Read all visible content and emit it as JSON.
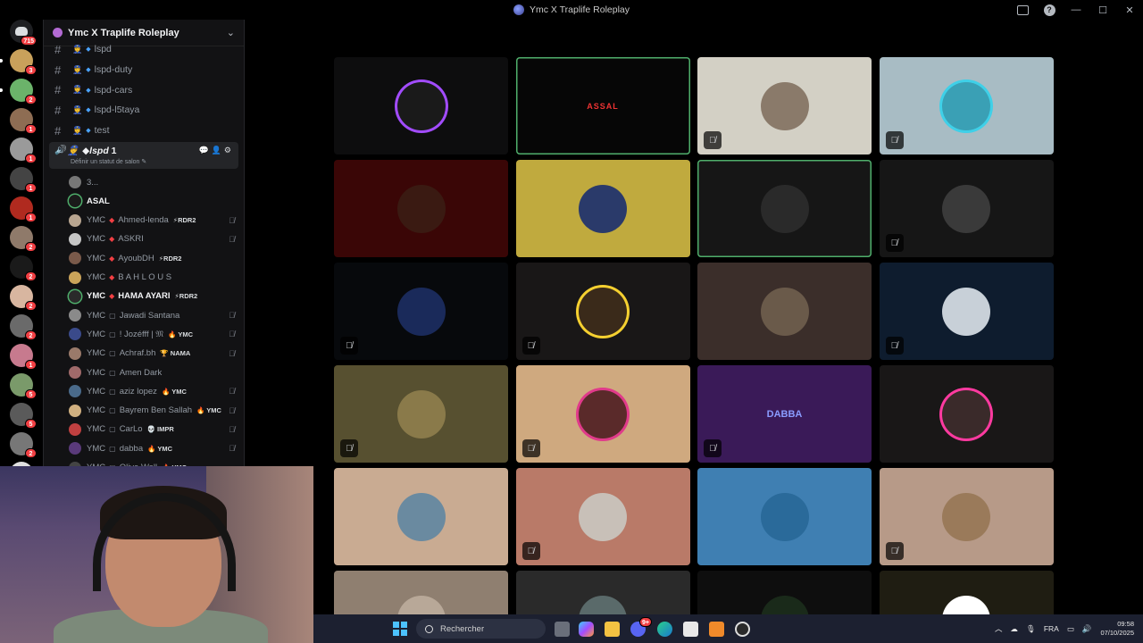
{
  "window": {
    "title": "Ymc X Traplife Roleplay"
  },
  "rail": {
    "home_badge": "715",
    "servers": [
      {
        "color": "#c9a15b",
        "badge": "3"
      },
      {
        "color": "#6bb36a",
        "badge": "2"
      },
      {
        "color": "#8e6d53",
        "badge": "1"
      },
      {
        "color": "#9a9a9a",
        "badge": "1"
      },
      {
        "color": "#444444",
        "badge": "1"
      },
      {
        "color": "#b02a1f",
        "badge": "1"
      },
      {
        "color": "#8f7a6a",
        "badge": "2"
      },
      {
        "color": "#1a1a1a",
        "badge": "2"
      },
      {
        "color": "#d8b6a0",
        "badge": "2"
      },
      {
        "color": "#6a6a6a",
        "badge": "2"
      },
      {
        "color": "#c77a8e",
        "badge": "1"
      },
      {
        "color": "#7a9a6a",
        "badge": "5"
      },
      {
        "color": "#5a5a5a",
        "badge": "5"
      },
      {
        "color": "#777777",
        "badge": "2"
      },
      {
        "color": "#e0e0e0",
        "badge": ""
      }
    ]
  },
  "guild": {
    "name": "Ymc X Traplife Roleplay"
  },
  "channels": [
    "lspd",
    "lspd-duty",
    "lspd-cars",
    "lspd-l5taya",
    "test"
  ],
  "voice": {
    "name": "lspd",
    "count": "1",
    "status_placeholder": "Définir un statut de salon ✎"
  },
  "members": [
    {
      "prefix": "",
      "name": "3...",
      "tag": "",
      "color": "#777777",
      "mark": "",
      "muted": false,
      "bright": false
    },
    {
      "prefix": "",
      "name": "ASAL",
      "tag": "",
      "color": "#1a1a1a",
      "mark": "",
      "muted": false,
      "bright": true
    },
    {
      "prefix": "YMC",
      "name": "Ahmed-lenda",
      "tag": "⚡RDR2",
      "color": "#b8a590",
      "mark": "◆",
      "muted": true,
      "bright": false
    },
    {
      "prefix": "YMC",
      "name": "ASKRI",
      "tag": "",
      "color": "#c5c5c5",
      "mark": "◆",
      "muted": true,
      "bright": false
    },
    {
      "prefix": "YMC",
      "name": "AyoubDH",
      "tag": "⚡RDR2",
      "color": "#7a5a4a",
      "mark": "◆",
      "muted": false,
      "bright": false
    },
    {
      "prefix": "YMC",
      "name": "B A H L O U S",
      "tag": "",
      "color": "#caa45a",
      "mark": "◆",
      "muted": false,
      "bright": false
    },
    {
      "prefix": "YMC",
      "name": "HAMA AYARI",
      "tag": "⚡RDR2",
      "color": "#2a2a2a",
      "mark": "◆",
      "muted": false,
      "bright": true
    },
    {
      "prefix": "YMC",
      "name": "Jawadi Santana",
      "tag": "",
      "color": "#8a8a8a",
      "mark": "▢",
      "muted": true,
      "bright": false
    },
    {
      "prefix": "YMC",
      "name": "! Jozéfff | 𝔐",
      "tag": "🔥 YMC",
      "color": "#3a4a8a",
      "mark": "▢",
      "muted": true,
      "bright": false
    },
    {
      "prefix": "YMC",
      "name": "Achraf.bh",
      "tag": "🏆 NAMA",
      "color": "#9a7a6a",
      "mark": "▢",
      "muted": true,
      "bright": false
    },
    {
      "prefix": "YMC",
      "name": "Amen Dark",
      "tag": "",
      "color": "#a06a6a",
      "mark": "▢",
      "muted": false,
      "bright": false
    },
    {
      "prefix": "YMC",
      "name": "aziz lopez",
      "tag": "🔥 YMC",
      "color": "#4a6a8a",
      "mark": "▢",
      "muted": true,
      "bright": false
    },
    {
      "prefix": "YMC",
      "name": "Bayrem Ben Sallah",
      "tag": "🔥 YMC",
      "color": "#d0b080",
      "mark": "▢",
      "muted": true,
      "bright": false
    },
    {
      "prefix": "YMC",
      "name": "CarLo",
      "tag": "💀 IMPR",
      "color": "#c04040",
      "mark": "▢",
      "muted": true,
      "bright": false
    },
    {
      "prefix": "YMC",
      "name": "dabba",
      "tag": "🔥 YMC",
      "color": "#5a3a7a",
      "mark": "▢",
      "muted": true,
      "bright": false
    },
    {
      "prefix": "YMC",
      "name": "Olive Wall",
      "tag": "🔥 YMC",
      "color": "#444444",
      "mark": "▢",
      "muted": false,
      "bright": false
    }
  ],
  "tiles": [
    {
      "bg": "#0d0d0e",
      "av": "#1a1a1a",
      "ring": "#a24cff",
      "speaking": false,
      "muted": false,
      "text": ""
    },
    {
      "bg": "#060606",
      "av": "",
      "ring": "",
      "speaking": true,
      "muted": false,
      "text": "ASSAL"
    },
    {
      "bg": "#d3d0c5",
      "av": "#8a7a6a",
      "ring": "",
      "speaking": false,
      "muted": true,
      "text": ""
    },
    {
      "bg": "#a8bcc4",
      "av": "#3aa0b5",
      "ring": "#3fd0e8",
      "speaking": false,
      "muted": true,
      "text": ""
    },
    {
      "bg": "#3a0606",
      "av": "#3a1a12",
      "ring": "",
      "speaking": false,
      "muted": false,
      "text": ""
    },
    {
      "bg": "#c0aa3e",
      "av": "#2a3a6a",
      "ring": "",
      "speaking": false,
      "muted": false,
      "text": ""
    },
    {
      "bg": "#161616",
      "av": "#2a2a2a",
      "ring": "",
      "speaking": true,
      "muted": false,
      "text": ""
    },
    {
      "bg": "#161616",
      "av": "#3a3a3a",
      "ring": "",
      "speaking": false,
      "muted": true,
      "text": ""
    },
    {
      "bg": "#07090c",
      "av": "#1a2a5a",
      "ring": "",
      "speaking": false,
      "muted": true,
      "text": ""
    },
    {
      "bg": "#191717",
      "av": "#3a2a1a",
      "ring": "#f5d030",
      "speaking": false,
      "muted": true,
      "text": ""
    },
    {
      "bg": "#3b2e2a",
      "av": "#6a5a4a",
      "ring": "",
      "speaking": false,
      "muted": false,
      "text": ""
    },
    {
      "bg": "#0e1c2e",
      "av": "#c8d0d8",
      "ring": "",
      "speaking": false,
      "muted": true,
      "text": ""
    },
    {
      "bg": "#575030",
      "av": "#8a7a4a",
      "ring": "",
      "speaking": false,
      "muted": true,
      "text": ""
    },
    {
      "bg": "#cfa97f",
      "av": "#5a2a2a",
      "ring": "#e03a8a",
      "speaking": false,
      "muted": true,
      "text": ""
    },
    {
      "bg": "#3a1a58",
      "av": "",
      "ring": "",
      "speaking": false,
      "muted": true,
      "text": "DABBA"
    },
    {
      "bg": "#191717",
      "av": "#3a2a2a",
      "ring": "#ff3aa0",
      "speaking": false,
      "muted": false,
      "text": ""
    },
    {
      "bg": "#c9ab92",
      "av": "#6a8aa0",
      "ring": "",
      "speaking": false,
      "muted": false,
      "text": ""
    },
    {
      "bg": "#b97a68",
      "av": "#c8c0b8",
      "ring": "",
      "speaking": false,
      "muted": true,
      "text": ""
    },
    {
      "bg": "#3f7fb2",
      "av": "#2a6a9a",
      "ring": "",
      "speaking": false,
      "muted": false,
      "text": ""
    },
    {
      "bg": "#b79a88",
      "av": "#9a7a5a",
      "ring": "",
      "speaking": false,
      "muted": true,
      "text": ""
    },
    {
      "bg": "#8f7f70",
      "av": "#b8a898",
      "ring": "",
      "speaking": false,
      "muted": false,
      "text": ""
    },
    {
      "bg": "#2a2a2a",
      "av": "#5a6a6a",
      "ring": "",
      "speaking": false,
      "muted": false,
      "text": ""
    },
    {
      "bg": "#0e0e0e",
      "av": "#1a2a1a",
      "ring": "",
      "speaking": false,
      "muted": false,
      "text": ""
    },
    {
      "bg": "#1f1d12",
      "av": "#ffffff",
      "ring": "",
      "speaking": false,
      "muted": false,
      "text": ""
    }
  ],
  "taskbar": {
    "search_placeholder": "Rechercher",
    "lang": "FRA",
    "time": "09:58",
    "date": "07/10/2025",
    "discord_badge": "9+"
  },
  "colors": {
    "accent_green": "#4fae6b",
    "badge_red": "#f23f43",
    "channel_blue": "#4aa3ff"
  }
}
